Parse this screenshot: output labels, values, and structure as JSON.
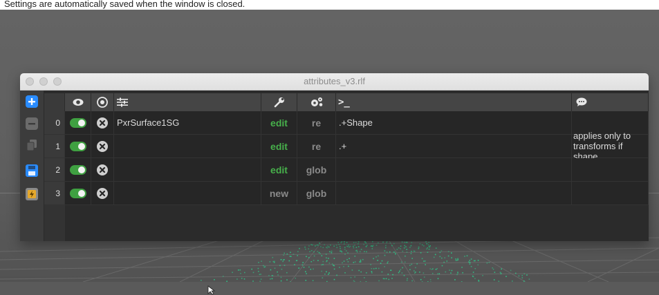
{
  "caption": {
    "text": "Settings are automatically saved when the window is closed."
  },
  "window": {
    "title": "attributes_v3.rlf"
  },
  "toolbar": {
    "buttons": [
      {
        "icon": "plus-icon",
        "color": "#2a8cff"
      },
      {
        "icon": "minus-icon",
        "color": "#6b6b6b"
      },
      {
        "icon": "duplicate-icon",
        "color": "#6b6b6b"
      },
      {
        "icon": "save-icon",
        "color": "#2a8cff"
      },
      {
        "icon": "load-icon",
        "color": "#e5a82c"
      }
    ]
  },
  "table": {
    "headers": {
      "enabled_icon": "eye-icon",
      "solo_icon": "target-icon",
      "group_icon": "sliders-icon",
      "edit_icon": "wrench-icon",
      "mode_icon": "gears-icon",
      "pattern_label": ">_",
      "note_icon": "speech-bubble-icon"
    },
    "rows": [
      {
        "index": "0",
        "group": "PxrSurface1SG",
        "action": "edit",
        "action_type": "edit",
        "mode": "re",
        "pattern": ".+Shape",
        "note": ""
      },
      {
        "index": "1",
        "group": "",
        "action": "edit",
        "action_type": "edit",
        "mode": "re",
        "pattern": ".+",
        "note": "applies only to\ntransforms if shape..."
      },
      {
        "index": "2",
        "group": "",
        "action": "edit",
        "action_type": "edit",
        "mode": "glob",
        "pattern": "",
        "note": ""
      },
      {
        "index": "3",
        "group": "",
        "action": "new",
        "action_type": "new",
        "mode": "glob",
        "pattern": "",
        "note": ""
      }
    ]
  },
  "colors": {
    "toggle_on": "#3fa041",
    "edit_green": "#47b04b",
    "accent_blue": "#2a8cff",
    "particles": "#2ec98a"
  }
}
